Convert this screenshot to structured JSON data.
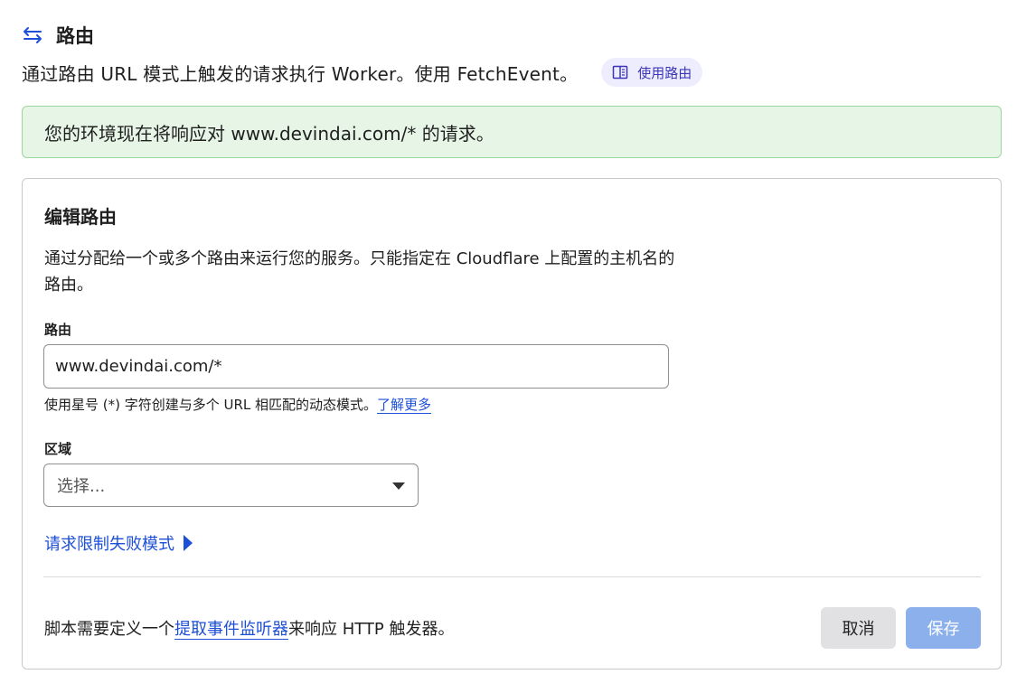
{
  "header": {
    "title": "路由",
    "description": "通过路由 URL 模式上触发的请求执行 Worker。使用 FetchEvent。",
    "doc_link": "使用路由"
  },
  "banner": {
    "message": "您的环境现在将响应对 www.devindai.com/* 的请求。"
  },
  "edit_card": {
    "title": "编辑路由",
    "description": "通过分配给一个或多个路由来运行您的服务。只能指定在 Cloudflare 上配置的主机名的路由。",
    "route_label": "路由",
    "route_value": "www.devindai.com/*",
    "route_hint": "使用星号 (*) 字符创建与多个 URL 相匹配的动态模式。",
    "learn_more": "了解更多",
    "zone_label": "区域",
    "zone_placeholder": "选择...",
    "fail_mode_link": "请求限制失败模式",
    "footer_prefix": "脚本需要定义一个",
    "footer_link": "提取事件监听器",
    "footer_suffix": "来响应 HTTP 触发器。",
    "cancel_label": "取消",
    "save_label": "保存"
  },
  "colors": {
    "accent": "#1d4fd8",
    "banner_bg": "#e6f5e6",
    "banner_border": "#9ed79e",
    "save_disabled": "#8cb0ec",
    "pill_bg": "#eeedfd"
  },
  "icons": {
    "route": "route-arrows-icon",
    "doc": "book-icon",
    "caret": "chevron-down-icon",
    "expand": "triangle-right-icon"
  }
}
